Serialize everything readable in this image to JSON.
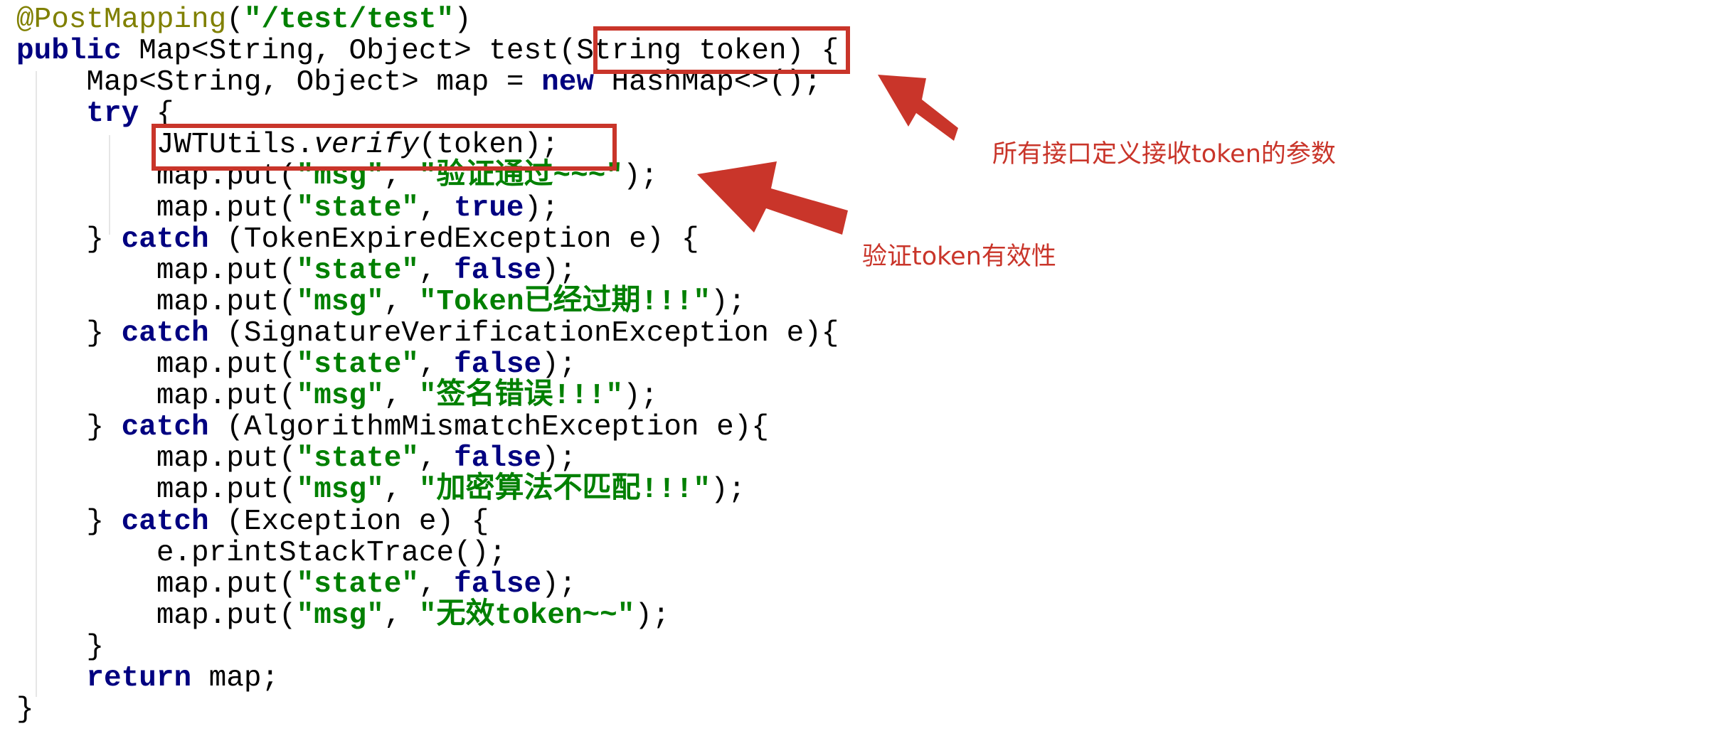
{
  "code": {
    "lines": [
      [
        [
          "a",
          "@PostMapping"
        ],
        [
          "p",
          "("
        ],
        [
          "s",
          "\"/test/test\""
        ],
        [
          "p",
          ")"
        ]
      ],
      [
        [
          "k",
          "public"
        ],
        [
          "p",
          " Map<String, Object> test(String token) {"
        ]
      ],
      [
        [
          "p",
          "    Map<String, Object> map = "
        ],
        [
          "k",
          "new"
        ],
        [
          "p",
          " HashMap<>();"
        ]
      ],
      [
        [
          "p",
          "    "
        ],
        [
          "k",
          "try"
        ],
        [
          "p",
          " {"
        ]
      ],
      [
        [
          "p",
          "        JWTUtils."
        ],
        [
          "i",
          "verify"
        ],
        [
          "p",
          "(token);"
        ]
      ],
      [
        [
          "p",
          "        map.put("
        ],
        [
          "s",
          "\"msg\""
        ],
        [
          "p",
          ", "
        ],
        [
          "s",
          "\"验证通过~~~\""
        ],
        [
          "p",
          ");"
        ]
      ],
      [
        [
          "p",
          "        map.put("
        ],
        [
          "s",
          "\"state\""
        ],
        [
          "p",
          ", "
        ],
        [
          "k",
          "true"
        ],
        [
          "p",
          ");"
        ]
      ],
      [
        [
          "p",
          "    } "
        ],
        [
          "k",
          "catch"
        ],
        [
          "p",
          " (TokenExpiredException e) {"
        ]
      ],
      [
        [
          "p",
          "        map.put("
        ],
        [
          "s",
          "\"state\""
        ],
        [
          "p",
          ", "
        ],
        [
          "k",
          "false"
        ],
        [
          "p",
          ");"
        ]
      ],
      [
        [
          "p",
          "        map.put("
        ],
        [
          "s",
          "\"msg\""
        ],
        [
          "p",
          ", "
        ],
        [
          "s",
          "\"Token已经过期!!!\""
        ],
        [
          "p",
          ");"
        ]
      ],
      [
        [
          "p",
          "    } "
        ],
        [
          "k",
          "catch"
        ],
        [
          "p",
          " (SignatureVerificationException e){"
        ]
      ],
      [
        [
          "p",
          "        map.put("
        ],
        [
          "s",
          "\"state\""
        ],
        [
          "p",
          ", "
        ],
        [
          "k",
          "false"
        ],
        [
          "p",
          ");"
        ]
      ],
      [
        [
          "p",
          "        map.put("
        ],
        [
          "s",
          "\"msg\""
        ],
        [
          "p",
          ", "
        ],
        [
          "s",
          "\"签名错误!!!\""
        ],
        [
          "p",
          ");"
        ]
      ],
      [
        [
          "p",
          "    } "
        ],
        [
          "k",
          "catch"
        ],
        [
          "p",
          " (AlgorithmMismatchException e){"
        ]
      ],
      [
        [
          "p",
          "        map.put("
        ],
        [
          "s",
          "\"state\""
        ],
        [
          "p",
          ", "
        ],
        [
          "k",
          "false"
        ],
        [
          "p",
          ");"
        ]
      ],
      [
        [
          "p",
          "        map.put("
        ],
        [
          "s",
          "\"msg\""
        ],
        [
          "p",
          ", "
        ],
        [
          "s",
          "\"加密算法不匹配!!!\""
        ],
        [
          "p",
          ");"
        ]
      ],
      [
        [
          "p",
          "    } "
        ],
        [
          "k",
          "catch"
        ],
        [
          "p",
          " (Exception e) {"
        ]
      ],
      [
        [
          "p",
          "        e.printStackTrace();"
        ]
      ],
      [
        [
          "p",
          "        map.put("
        ],
        [
          "s",
          "\"state\""
        ],
        [
          "p",
          ", "
        ],
        [
          "k",
          "false"
        ],
        [
          "p",
          ");"
        ]
      ],
      [
        [
          "p",
          "        map.put("
        ],
        [
          "s",
          "\"msg\""
        ],
        [
          "p",
          ", "
        ],
        [
          "s",
          "\"无效token~~\""
        ],
        [
          "p",
          ");"
        ]
      ],
      [
        [
          "p",
          "    }"
        ]
      ],
      [
        [
          "p",
          "    "
        ],
        [
          "k",
          "return"
        ],
        [
          "p",
          " map;"
        ]
      ],
      [
        [
          "p",
          "}"
        ]
      ]
    ]
  },
  "annotations": {
    "param_note": "所有接口定义接收token的参数",
    "verify_note": "验证token有效性",
    "color": "#c9352a",
    "arrow_icon": "arrow-icon"
  },
  "colors": {
    "annotation": "#808000",
    "keyword": "#000080",
    "string": "#008000"
  }
}
